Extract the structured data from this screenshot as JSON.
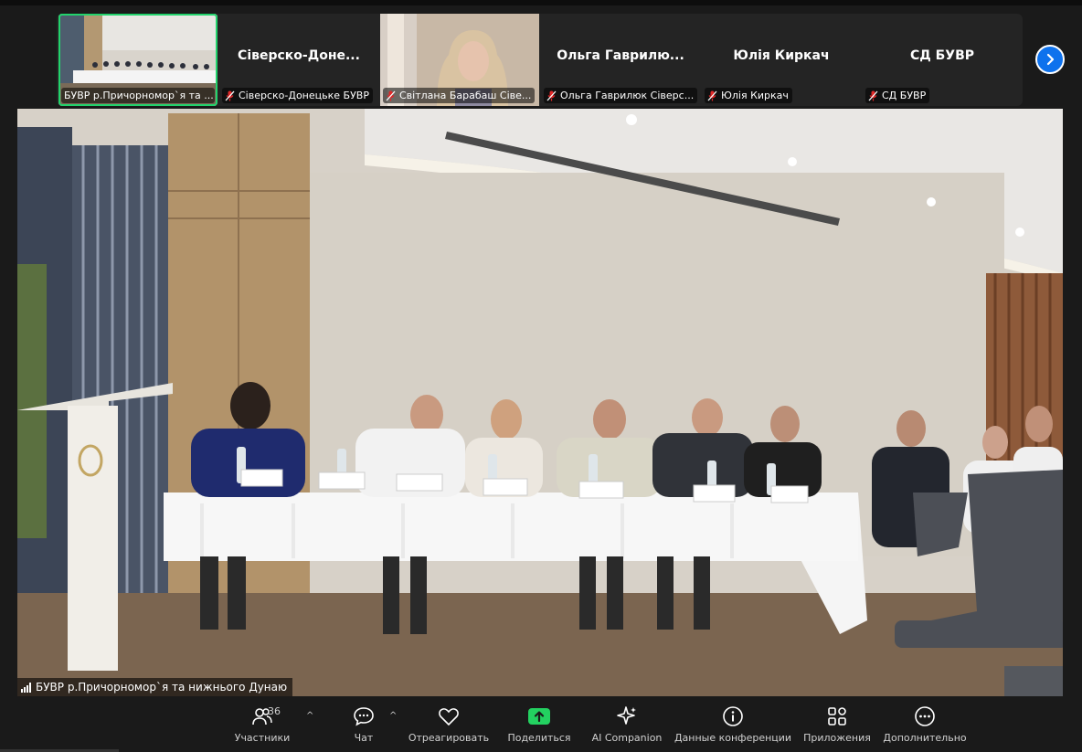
{
  "gallery": {
    "tiles": [
      {
        "label": "БУВР р.Причорномор`я та ..."
      },
      {
        "name": "Сіверско-Доне...",
        "label": "Сіверско-Донецьке БУВР"
      },
      {
        "label": "Світлана Барабаш Сіве..."
      },
      {
        "name": "Ольга  Гаврилю...",
        "label": "Ольга Гаврилюк Сіверс..."
      },
      {
        "name": "Юлія Киркач",
        "label": "Юлія Киркач"
      },
      {
        "name": "СД БУВР",
        "label": "СД БУВР"
      }
    ]
  },
  "main": {
    "speaker_label": "БУВР р.Причорномор`я та нижнього Дунаю"
  },
  "toolbar": {
    "participants_label": "Участники",
    "participants_count": "36",
    "chat_label": "Чат",
    "react_label": "Отреагировать",
    "share_label": "Поделиться",
    "ai_label": "AI Companion",
    "info_label": "Данные конференции",
    "apps_label": "Приложения",
    "more_label": "Дополнительно"
  },
  "colors": {
    "active_border": "#22d36c",
    "accent_blue": "#0e72ed",
    "share_green": "#23d160",
    "mic_off_red": "#e02828"
  }
}
